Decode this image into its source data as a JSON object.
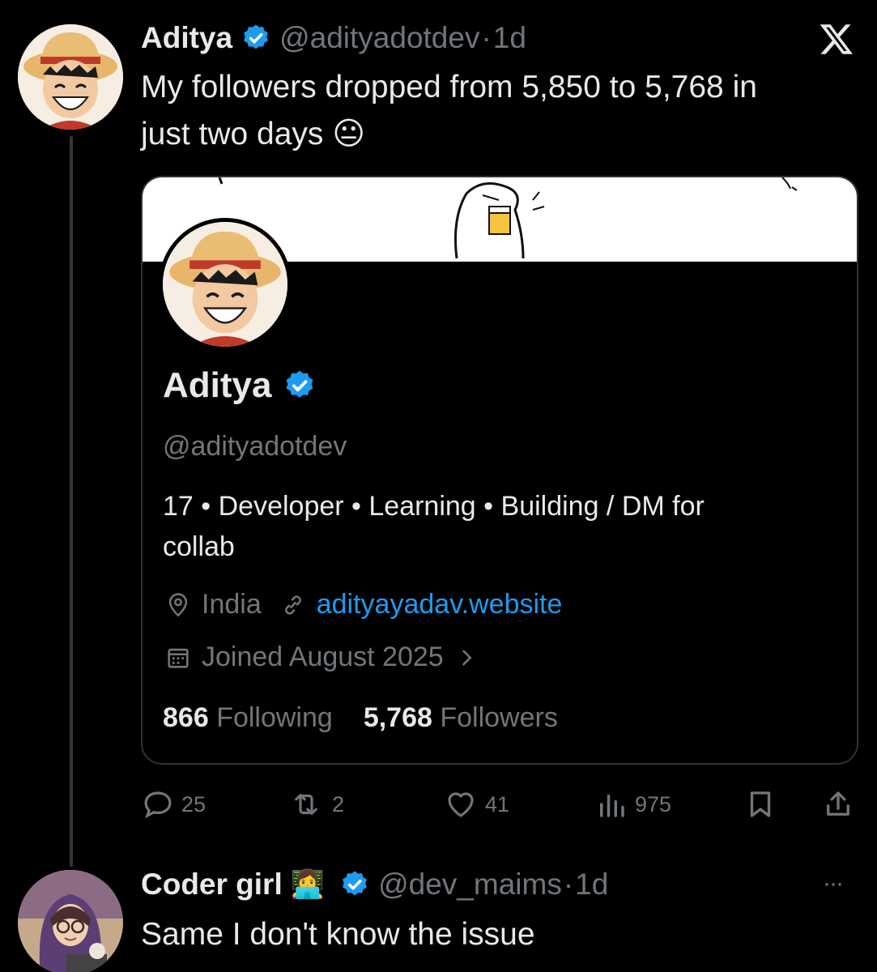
{
  "colors": {
    "background": "#000000",
    "text": "#e7e9ea",
    "muted": "#71767b",
    "accent": "#1d9bf0",
    "border": "#2f3336"
  },
  "post": {
    "author_name": "Aditya",
    "author_handle": "@adityadotdev",
    "separator": "·",
    "time": "1d",
    "text_line1": "My followers dropped from 5,850 to 5,768 in",
    "text_line2": "just two days",
    "emoji": "😐"
  },
  "x_logo": "𝕏",
  "card": {
    "name": "Aditya",
    "handle": "@adityadotdev",
    "bio_line1": "17 • Developer • Learning • Building / DM for",
    "bio_line2": "collab",
    "location": "India",
    "website": "adityayadav.website",
    "joined": "Joined August 2025",
    "following_count": "866",
    "following_label": "Following",
    "followers_count": "5,768",
    "followers_label": "Followers"
  },
  "actions": {
    "replies": "25",
    "reposts": "2",
    "likes": "41",
    "views": "975"
  },
  "reply": {
    "author_name": "Coder girl",
    "emoji": "👩‍💻",
    "author_handle": "@dev_maims",
    "separator": "·",
    "time": "1d",
    "text": "Same I don't know the issue",
    "more": "···"
  }
}
